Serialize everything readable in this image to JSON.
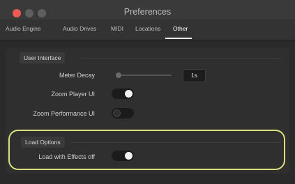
{
  "window": {
    "title": "Preferences"
  },
  "tabs": [
    {
      "label": "Audio Engine"
    },
    {
      "label": "Audio Drives"
    },
    {
      "label": "MIDI"
    },
    {
      "label": "Locations"
    },
    {
      "label": "Other",
      "active": true
    }
  ],
  "user_interface": {
    "title": "User Interface",
    "meter_decay": {
      "label": "Meter Decay",
      "value": "1s",
      "slider_level": 0
    },
    "zoom_player_ui": {
      "label": "Zoom Player UI",
      "state": "on"
    },
    "zoom_performance_ui": {
      "label": "Zoom Performance UI",
      "state": "off"
    }
  },
  "load_options": {
    "title": "Load Options",
    "load_with_effects_off": {
      "label": "Load with Effects off",
      "state": "on"
    }
  },
  "colors": {
    "close_button": "#ee5a52",
    "highlight_outline": "#dce07c",
    "toggle_on_knob": "#f2f2f2"
  }
}
